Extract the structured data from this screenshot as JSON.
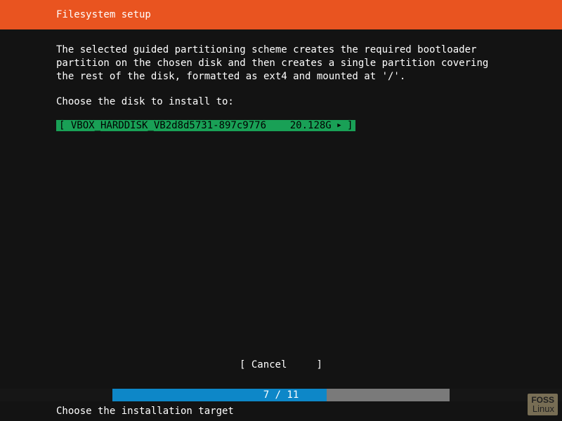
{
  "header": {
    "title": "Filesystem setup"
  },
  "body": {
    "description": "The selected guided partitioning scheme creates the required bootloader partition on the chosen disk and then creates a single partition covering the rest of the disk, formatted as ext4 and mounted at '/'.",
    "prompt": "Choose the disk to install to:"
  },
  "disk": {
    "open_bracket": "[ ",
    "label": "VBOX_HARDDISK_VB2d8d5731-897c9776",
    "size": "20.128G",
    "arrow": "▶",
    "close_bracket": " ]"
  },
  "cancel": {
    "text": "[ Cancel     ]"
  },
  "progress": {
    "current": 7,
    "total": 11,
    "label": "7 / 11",
    "percent": 63.6
  },
  "footer": {
    "hint": "Choose the installation target"
  },
  "watermark": {
    "line1": "FOSS",
    "line2": "Linux"
  }
}
